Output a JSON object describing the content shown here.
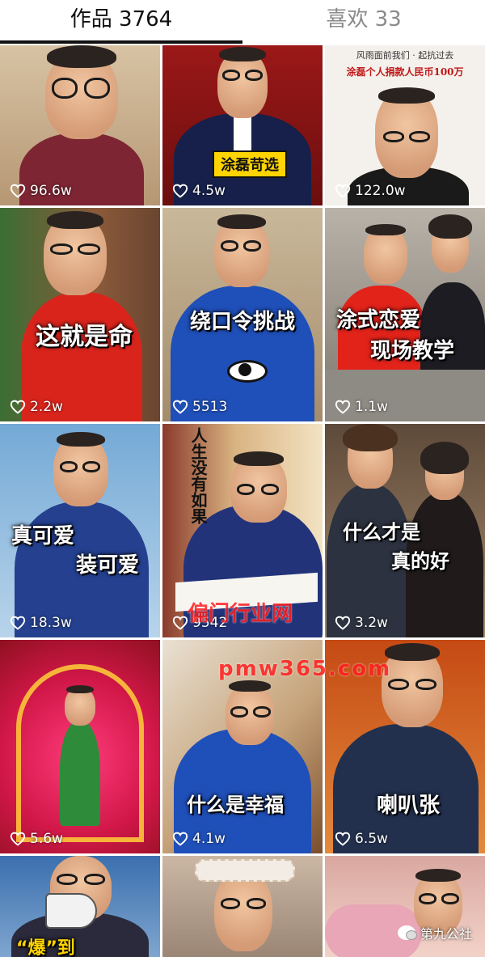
{
  "tabs": {
    "works": "作品 3764",
    "likes": "喜欢 33"
  },
  "tiles": [
    {
      "likes": "96.6w"
    },
    {
      "likes": "4.5w",
      "caption": "涂磊苛选"
    },
    {
      "likes": "122.0w",
      "top_line1": "风雨面前我们 · 起抗过去",
      "top_line2": "涂磊个人捐款人民币100万"
    },
    {
      "likes": "2.2w",
      "caption": "这就是命"
    },
    {
      "likes": "5513",
      "caption": "绕口令挑战"
    },
    {
      "likes": "1.1w",
      "caption1": "涂式恋爱",
      "caption2": "现场教学"
    },
    {
      "likes": "18.3w",
      "caption1": "真可爱",
      "caption2": "装可爱"
    },
    {
      "likes": "9542",
      "caption": "人生没有如果"
    },
    {
      "likes": "3.2w",
      "caption1": "什么才是",
      "caption2": "真的好"
    },
    {
      "likes": "5.6w"
    },
    {
      "likes": "4.1w",
      "caption": "什么是幸福"
    },
    {
      "likes": "6.5w",
      "caption": "喇叭张"
    },
    {
      "caption": "“爆”到"
    },
    {},
    {}
  ],
  "watermark": {
    "line1": "偏门行业网",
    "line2": "pmw365.com"
  },
  "wechat_source": "第九公社",
  "colors": {
    "heart": "#ffffff",
    "caption_yellow": "#ffd400",
    "watermark": "#ff1f1f"
  }
}
